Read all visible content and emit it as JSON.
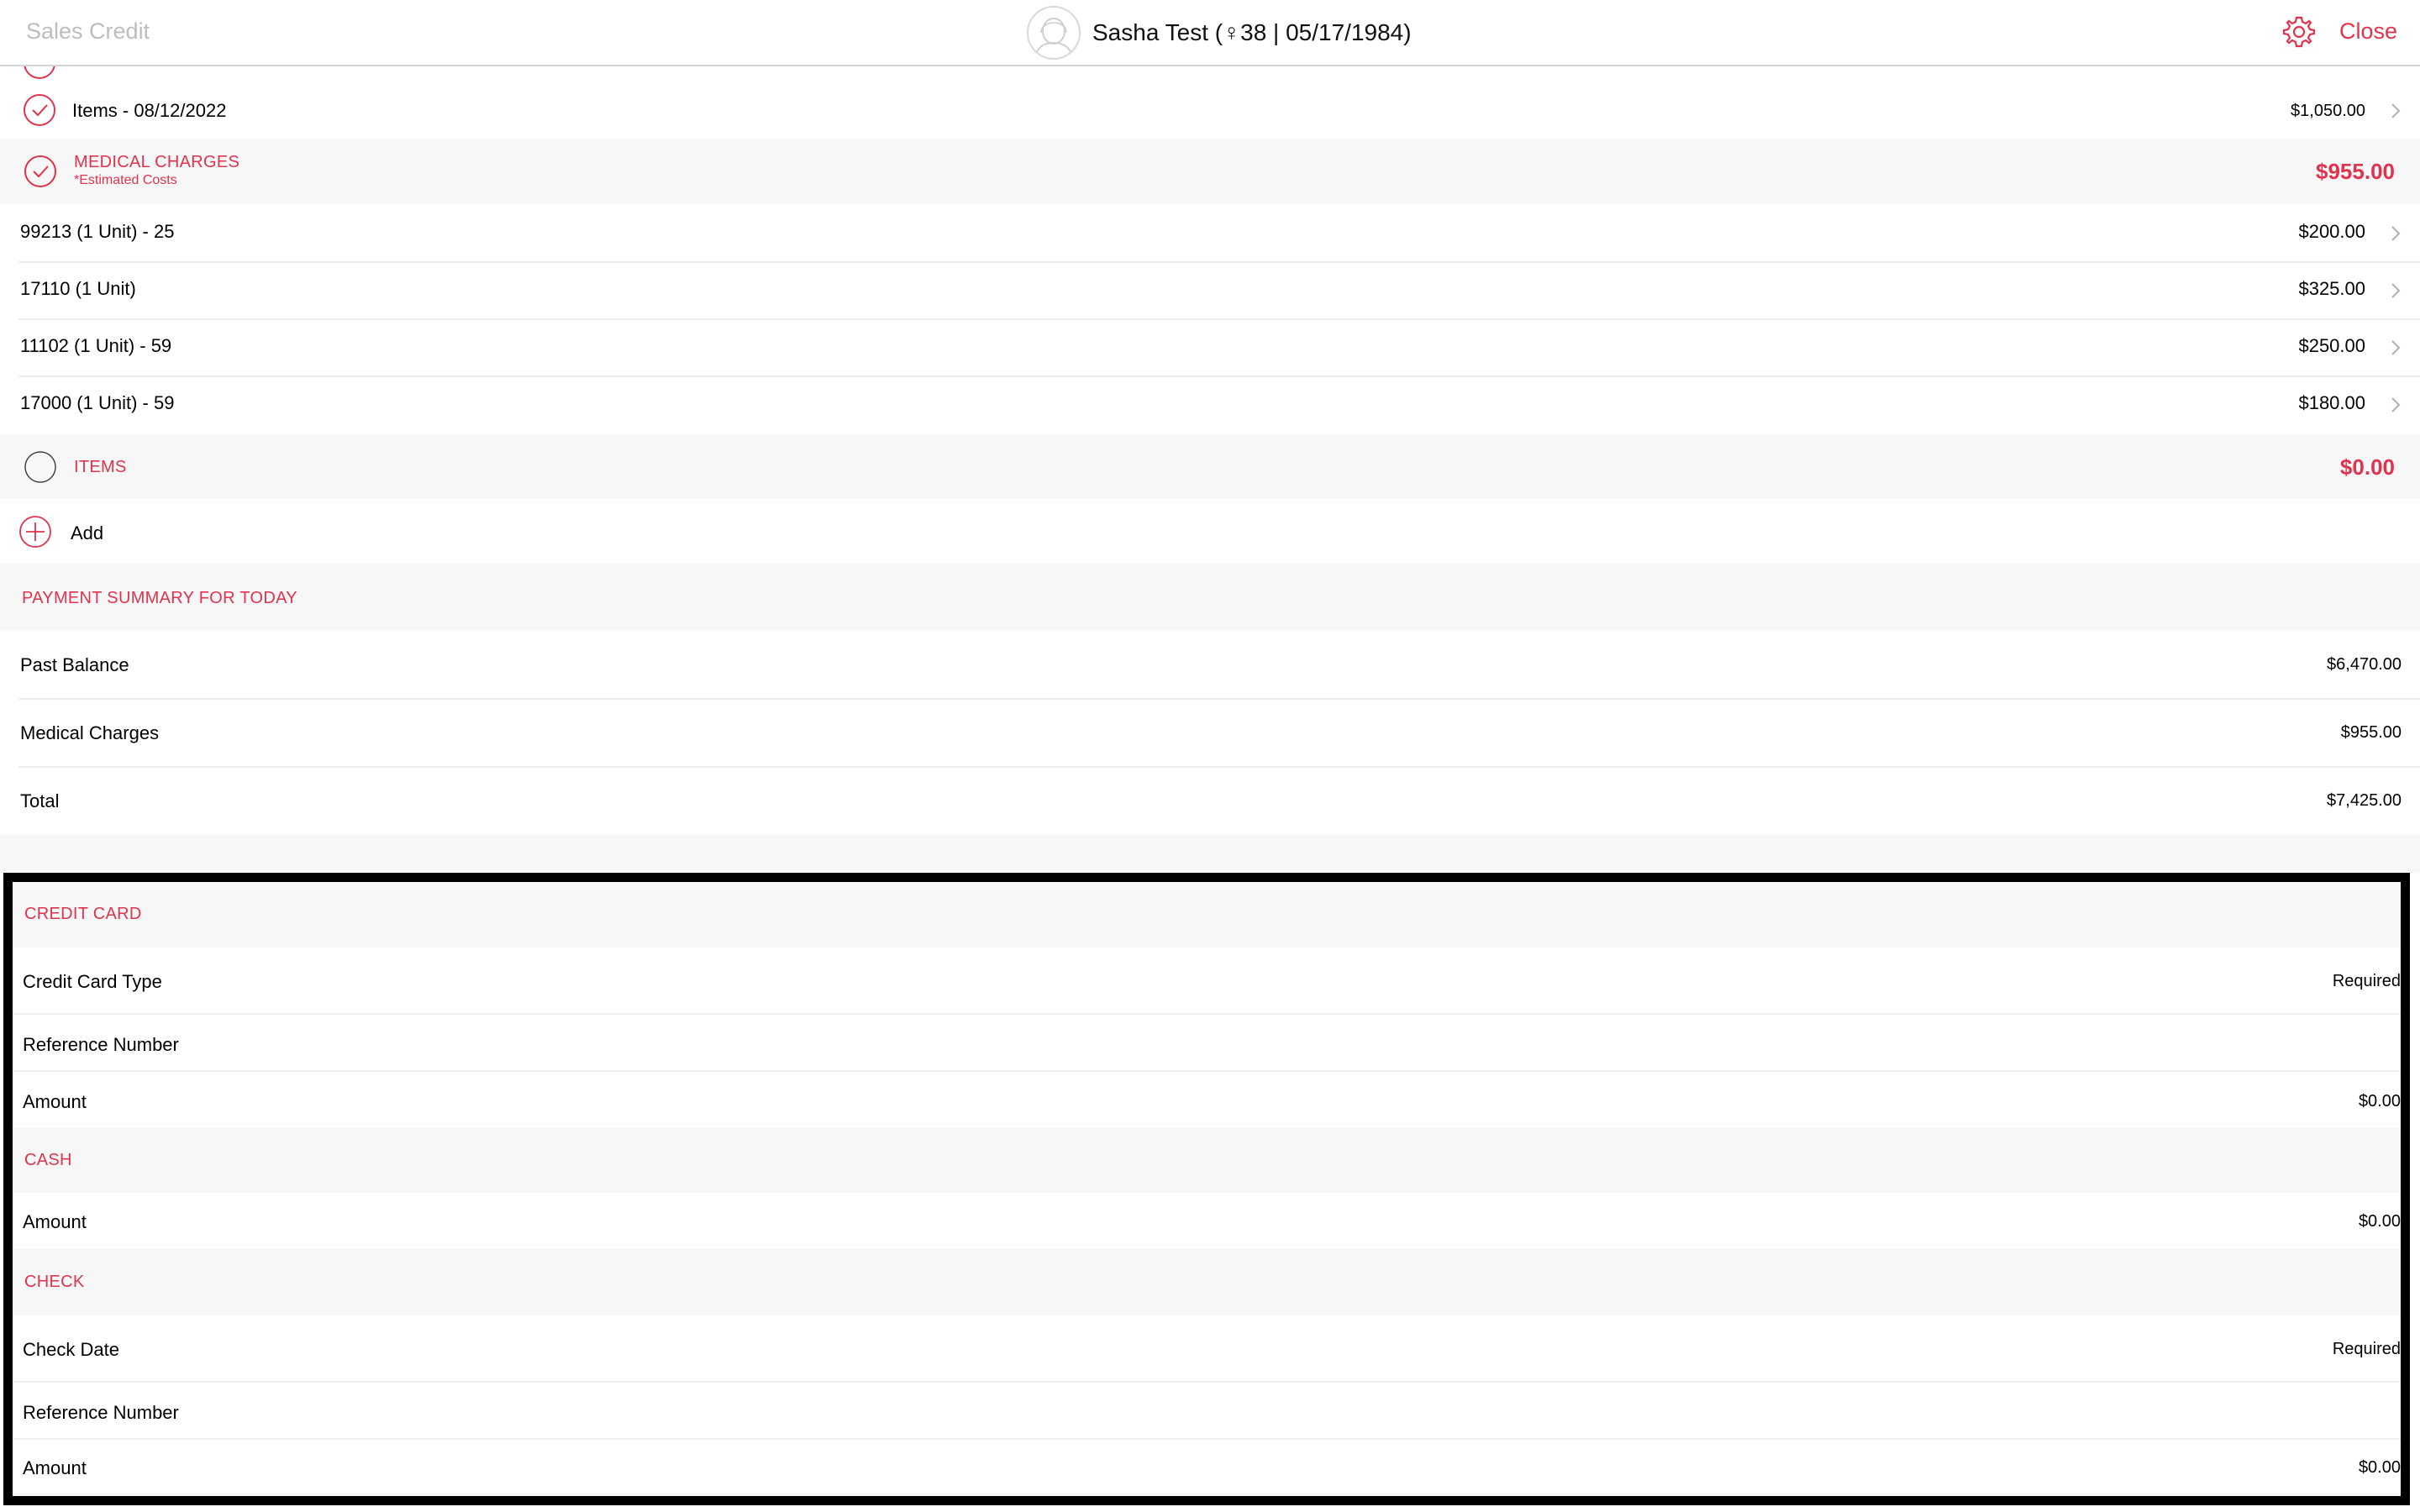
{
  "header": {
    "back_title": "Sales Credit",
    "patient_label": "Sasha Test (♀38 | 05/17/1984)",
    "close_label": "Close",
    "settings_icon": "gear-icon"
  },
  "colors": {
    "accent": "#e0334d",
    "section_bg": "#f7f7f7"
  },
  "items_row": {
    "label": "Items - 08/12/2022",
    "value": "$1,050.00"
  },
  "medical_charges": {
    "title": "MEDICAL CHARGES",
    "subtitle": "*Estimated Costs",
    "total": "$955.00",
    "lines": [
      {
        "label": "99213 (1 Unit) - 25",
        "value": "$200.00"
      },
      {
        "label": "17110 (1 Unit)",
        "value": "$325.00"
      },
      {
        "label": "11102 (1 Unit) - 59",
        "value": "$250.00"
      },
      {
        "label": "17000 (1 Unit) - 59",
        "value": "$180.00"
      }
    ]
  },
  "items_section": {
    "title": "ITEMS",
    "total": "$0.00",
    "add_label": "Add"
  },
  "payment_summary": {
    "title": "PAYMENT SUMMARY FOR TODAY",
    "rows": [
      {
        "label": "Past Balance",
        "value": "$6,470.00"
      },
      {
        "label": "Medical Charges",
        "value": "$955.00"
      },
      {
        "label": "Total",
        "value": "$7,425.00"
      }
    ]
  },
  "credit_card": {
    "title": "CREDIT CARD",
    "type_label": "Credit Card Type",
    "type_value": "Required",
    "ref_label": "Reference Number",
    "amount_label": "Amount",
    "amount_value": "$0.00"
  },
  "cash": {
    "title": "CASH",
    "amount_label": "Amount",
    "amount_value": "$0.00"
  },
  "check": {
    "title": "CHECK",
    "date_label": "Check Date",
    "date_value": "Required",
    "ref_label": "Reference Number",
    "amount_label": "Amount",
    "amount_value": "$0.00"
  }
}
